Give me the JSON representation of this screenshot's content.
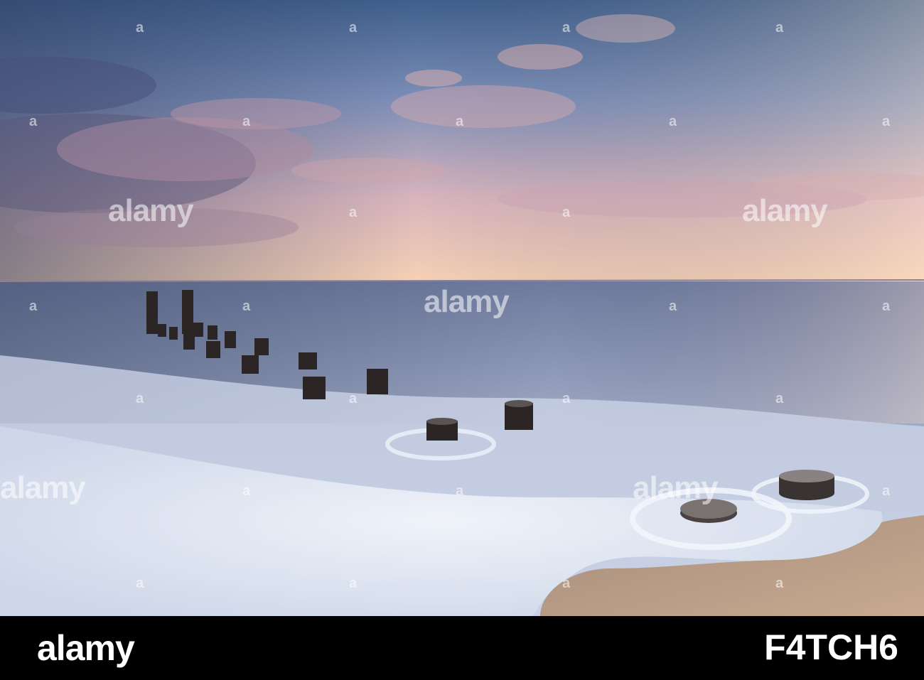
{
  "watermark": {
    "text": "alamy",
    "glyph": "a"
  },
  "footer": {
    "logo_text": "alamy",
    "image_id": "F4TCH6",
    "background_color": "#000000",
    "text_color": "#ffffff"
  },
  "photo": {
    "subject": "seascape-sunset-with-wooden-pilings",
    "colors": {
      "sky_top": "#4a6a95",
      "sky_horizon": "#f6c9a8",
      "sea": "#8e9ab8",
      "foam": "#e8eef6",
      "sand": "#b49a86",
      "posts": "#2a2424"
    }
  }
}
